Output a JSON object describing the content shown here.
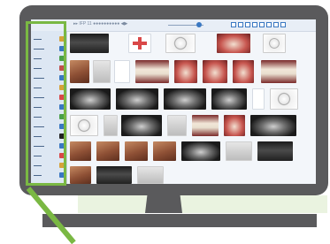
{
  "toolbar": {
    "left_text": "▸▸ IFP 11 ●●●●●●●●●● ◀▶",
    "icon_names": [
      "grid-icon",
      "grid-icon",
      "grid-icon",
      "grid-icon",
      "grid-icon",
      "grid-icon",
      "grid-icon",
      "grid-icon"
    ]
  },
  "sidebar": {
    "items": [
      {
        "label": "▬▬▬",
        "icon_color": "#d6a23a"
      },
      {
        "label": "▬▬▬▬",
        "icon_color": "#3a78c2"
      },
      {
        "label": "▬▬▬",
        "icon_color": "#4aa04a"
      },
      {
        "label": "▬▬▬",
        "icon_color": "#c0504d"
      },
      {
        "label": "▬▬▬▬",
        "icon_color": "#3a78c2"
      },
      {
        "label": "▬▬▬",
        "icon_color": "#d6a23a"
      },
      {
        "label": "▬▬▬▬",
        "icon_color": "#d94848"
      },
      {
        "label": "▬▬▬",
        "icon_color": "#3a78c2"
      },
      {
        "label": "▬▬▬",
        "icon_color": "#4aa04a"
      },
      {
        "label": "▬▬▬▬",
        "icon_color": "#3a78c2"
      },
      {
        "label": "▬▬▬",
        "icon_color": "#222222"
      },
      {
        "label": "▬▬▬▬",
        "icon_color": "#3a78c2"
      },
      {
        "label": "▬▬▬",
        "icon_color": "#d94848"
      },
      {
        "label": "▬▬▬",
        "icon_color": "#d6a23a"
      },
      {
        "label": "▬▬▬",
        "icon_color": "#3a78c2"
      }
    ]
  },
  "colors": {
    "accent_green": "#7ab843",
    "monitor_frame": "#5a5a5c",
    "ui_blue": "#3a78c2"
  }
}
